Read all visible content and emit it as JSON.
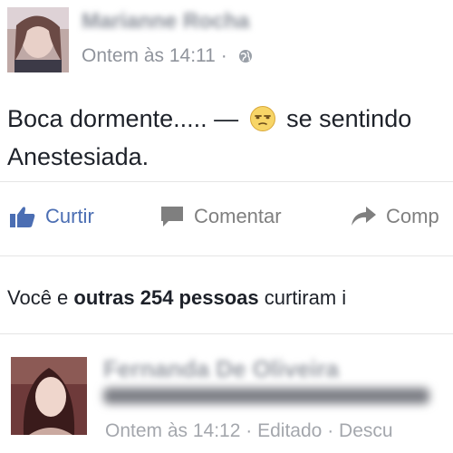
{
  "post": {
    "author_name_blurred": "Marianne Rocha",
    "timestamp": "Ontem às 14:11",
    "separator": "·",
    "privacy_icon": "globe-icon",
    "text_before": "Boca dormente..... — ",
    "feeling_emoji": "anesthetized-face-emoji",
    "text_after": " se sentindo Anestesiada."
  },
  "actions": {
    "like_label": "Curtir",
    "comment_label": "Comentar",
    "share_label": "Comp",
    "like_icon": "thumbs-up-icon",
    "comment_icon": "comment-bubble-icon",
    "share_icon": "share-arrow-icon"
  },
  "likes": {
    "prefix": "Você e ",
    "bold_part": "outras 254 pessoas",
    "suffix": " curtiram i"
  },
  "comment": {
    "author_name_blurred": "Fernanda De Oliveira",
    "timestamp": "Ontem às 14:12",
    "edited": "Editado",
    "more": "Descu"
  },
  "colors": {
    "link_blue": "#4b6eb3",
    "meta_gray": "#90949c",
    "text_dark": "#1d2129"
  }
}
